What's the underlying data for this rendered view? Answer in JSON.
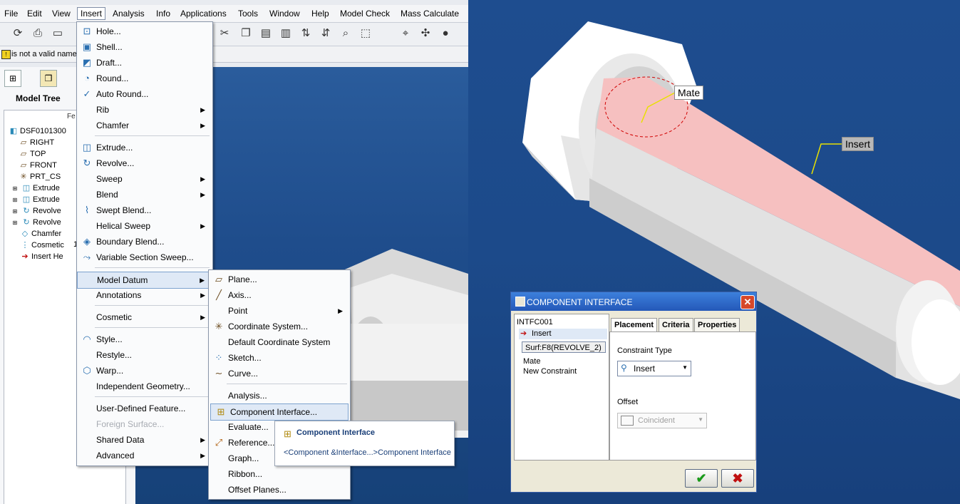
{
  "menubar": {
    "items": [
      "File",
      "Edit",
      "View",
      "Insert",
      "Analysis",
      "Info",
      "Applications",
      "Tools",
      "Window",
      "Help",
      "Model Check",
      "Mass Calculate"
    ]
  },
  "message_bar": {
    "text": "is not a valid name"
  },
  "model_tree": {
    "title": "Model Tree",
    "column_header": "Fe",
    "items": [
      {
        "label": "DSF0101300",
        "icon": "part-icon"
      },
      {
        "label": "RIGHT",
        "icon": "datum-plane-icon"
      },
      {
        "label": "TOP",
        "icon": "datum-plane-icon"
      },
      {
        "label": "FRONT",
        "icon": "datum-plane-icon"
      },
      {
        "label": "PRT_CS",
        "icon": "coordinate-system-icon"
      },
      {
        "label": "Extrude",
        "icon": "extrude-icon"
      },
      {
        "label": "Extrude",
        "icon": "extrude-icon"
      },
      {
        "label": "Revolve",
        "icon": "revolve-icon"
      },
      {
        "label": "Revolve",
        "icon": "revolve-icon"
      },
      {
        "label": "Chamfer",
        "icon": "chamfer-icon"
      },
      {
        "label": "Cosmetic",
        "icon": "cosmetic-icon"
      },
      {
        "label": "Insert He",
        "icon": "insert-here-arrow-icon"
      }
    ],
    "col_values": [
      "1"
    ]
  },
  "insert_menu": {
    "items": [
      {
        "label": "Hole...",
        "icon": "hole-icon"
      },
      {
        "label": "Shell...",
        "icon": "shell-icon"
      },
      {
        "label": "Draft...",
        "icon": "draft-icon"
      },
      {
        "label": "Round...",
        "icon": "round-icon"
      },
      {
        "label": "Auto Round...",
        "icon": "auto-round-icon"
      },
      {
        "label": "Rib",
        "submenu": true
      },
      {
        "label": "Chamfer",
        "submenu": true
      },
      {
        "label": "Extrude...",
        "icon": "extrude-icon"
      },
      {
        "label": "Revolve...",
        "icon": "revolve-icon"
      },
      {
        "label": "Sweep",
        "submenu": true
      },
      {
        "label": "Blend",
        "submenu": true
      },
      {
        "label": "Swept Blend...",
        "icon": "swept-blend-icon"
      },
      {
        "label": "Helical Sweep",
        "submenu": true
      },
      {
        "label": "Boundary Blend...",
        "icon": "boundary-blend-icon"
      },
      {
        "label": "Variable Section Sweep...",
        "icon": "variable-section-sweep-icon"
      },
      {
        "label": "Model Datum",
        "submenu": true
      },
      {
        "label": "Annotations",
        "submenu": true
      },
      {
        "label": "Cosmetic",
        "submenu": true
      },
      {
        "label": "Style...",
        "icon": "style-icon"
      },
      {
        "label": "Restyle..."
      },
      {
        "label": "Warp...",
        "icon": "warp-icon"
      },
      {
        "label": "Independent Geometry..."
      },
      {
        "label": "User-Defined Feature..."
      },
      {
        "label": "Foreign Surface..."
      },
      {
        "label": "Shared Data",
        "submenu": true
      },
      {
        "label": "Advanced",
        "submenu": true
      }
    ]
  },
  "datum_menu": {
    "items": [
      {
        "label": "Plane...",
        "icon": "plane-icon"
      },
      {
        "label": "Axis...",
        "icon": "axis-icon"
      },
      {
        "label": "Point",
        "submenu": true
      },
      {
        "label": "Coordinate System...",
        "icon": "csys-icon"
      },
      {
        "label": "Default Coordinate System"
      },
      {
        "label": "Sketch...",
        "icon": "sketch-icon"
      },
      {
        "label": "Curve...",
        "icon": "curve-icon"
      },
      {
        "label": "Analysis..."
      },
      {
        "label": "Component Interface...",
        "icon": "component-interface-icon"
      },
      {
        "label": "Evaluate..."
      },
      {
        "label": "Reference...",
        "icon": "reference-icon"
      },
      {
        "label": "Graph..."
      },
      {
        "label": "Ribbon..."
      },
      {
        "label": "Offset Planes..."
      }
    ]
  },
  "tooltip": {
    "title": "Component Interface",
    "path": "<Component &Interface...>Component Interface"
  },
  "scene": {
    "label_mate": "Mate",
    "label_insert": "Insert"
  },
  "dialog": {
    "title": "COMPONENT INTERFACE",
    "tree_root": "INTFC001",
    "selected_constraint": "Insert",
    "reference": "Surf:F8(REVOLVE_2)",
    "other_constraint": "Mate",
    "new_constraint": "New Constraint",
    "tabs": [
      "Placement",
      "Criteria",
      "Properties"
    ],
    "constraint_type_label": "Constraint Type",
    "constraint_type_value": "Insert",
    "offset_label": "Offset",
    "offset_value": "Coincident"
  },
  "colors": {
    "highlight_surface": "#f6c0c0",
    "background_blue": "#1c4a8a",
    "dialog_title": "#2458b8"
  }
}
